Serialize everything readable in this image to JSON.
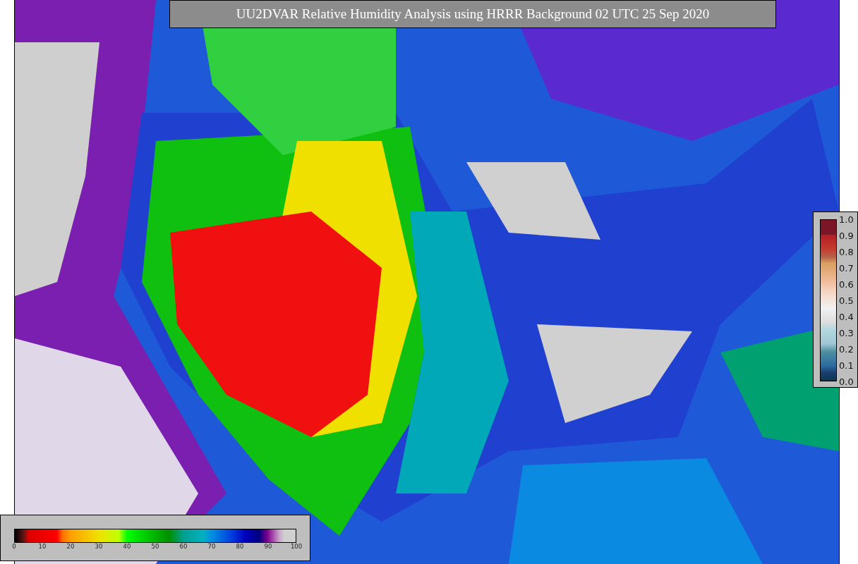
{
  "title": "UU2DVAR Relative Humidity Analysis using HRRR Background 02 UTC 25 Sep 2020",
  "observation_colorbar": {
    "tick_labels": [
      "1.0",
      "0.9",
      "0.8",
      "0.7",
      "0.6",
      "0.5",
      "0.4",
      "0.3",
      "0.2",
      "0.1",
      "0.0"
    ]
  },
  "humidity_colorbar": {
    "tick_labels": [
      "0",
      "10",
      "20",
      "30",
      "40",
      "50",
      "60",
      "70",
      "80",
      "90",
      "100"
    ]
  }
}
